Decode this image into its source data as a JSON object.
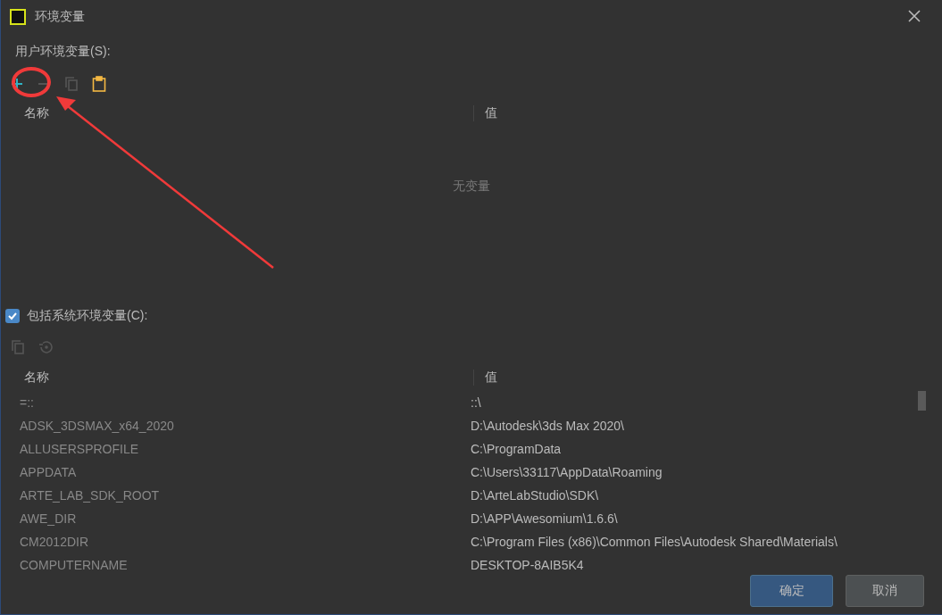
{
  "window": {
    "title": "环境变量"
  },
  "user_vars": {
    "label": "用户环境变量(S):",
    "toolbar": [
      {
        "kind": "add",
        "disabled": false
      },
      {
        "kind": "remove",
        "disabled": true
      },
      {
        "kind": "copy",
        "disabled": true
      },
      {
        "kind": "paste",
        "disabled": false
      }
    ],
    "columns": [
      "名称",
      "值"
    ],
    "empty_text": "无变量"
  },
  "system_vars": {
    "label": "包括系统环境变量(C):",
    "checked": true,
    "toolbar": [
      {
        "kind": "copy",
        "disabled": true
      },
      {
        "kind": "reset",
        "disabled": true
      }
    ],
    "columns": [
      "名称",
      "值"
    ],
    "rows": [
      {
        "name": "=::",
        "value": "::\\"
      },
      {
        "name": "ADSK_3DSMAX_x64_2020",
        "value": "D:\\Autodesk\\3ds Max 2020\\"
      },
      {
        "name": "ALLUSERSPROFILE",
        "value": "C:\\ProgramData"
      },
      {
        "name": "APPDATA",
        "value": "C:\\Users\\33117\\AppData\\Roaming"
      },
      {
        "name": "ARTE_LAB_SDK_ROOT",
        "value": "D:\\ArteLabStudio\\SDK\\"
      },
      {
        "name": "AWE_DIR",
        "value": "D:\\APP\\Awesomium\\1.6.6\\"
      },
      {
        "name": "CM2012DIR",
        "value": "C:\\Program Files (x86)\\Common Files\\Autodesk Shared\\Materials\\"
      },
      {
        "name": "COMPUTERNAME",
        "value": "DESKTOP-8AIB5K4"
      }
    ]
  },
  "buttons": [
    {
      "label": "确定",
      "kind": "default"
    },
    {
      "label": "取消",
      "kind": "normal"
    }
  ]
}
